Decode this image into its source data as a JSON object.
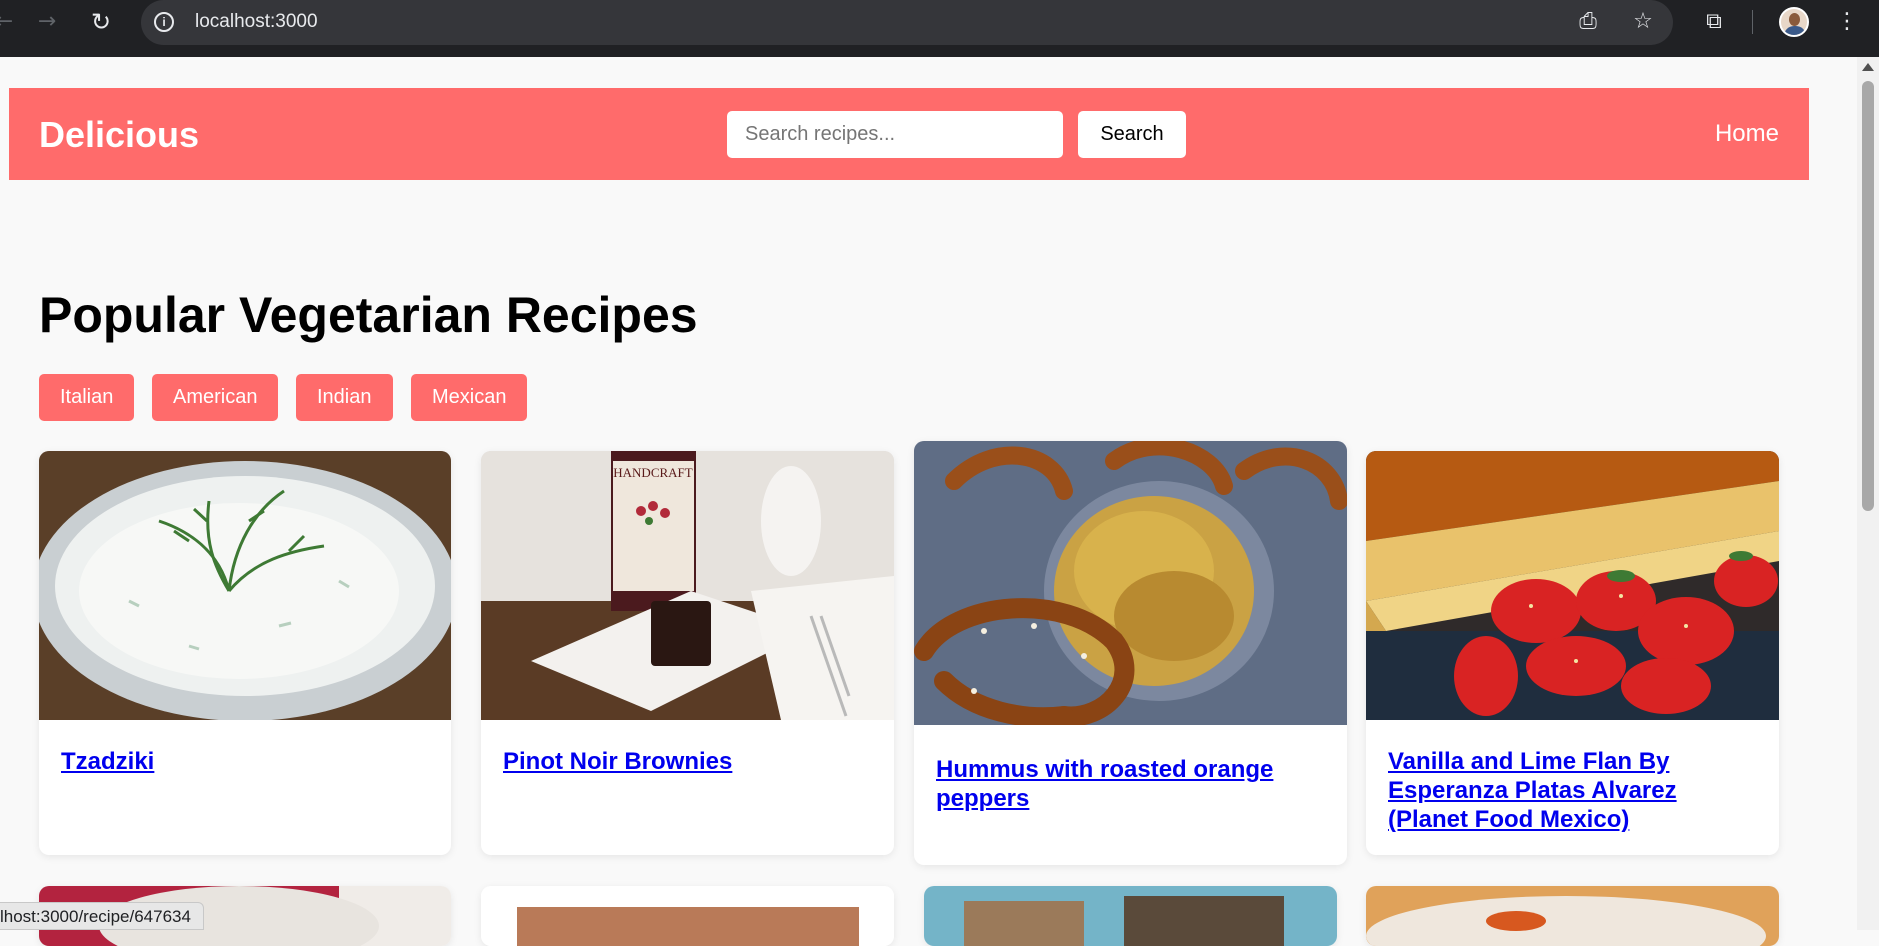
{
  "browser": {
    "url": "localhost:3000",
    "status_url": "lhost:3000/recipe/647634"
  },
  "header": {
    "brand": "Delicious",
    "search_placeholder": "Search recipes...",
    "search_button": "Search",
    "home_link": "Home",
    "accent_color": "#ff6b6b"
  },
  "main": {
    "title": "Popular Vegetarian Recipes",
    "cuisines": [
      "Italian",
      "American",
      "Indian",
      "Mexican"
    ],
    "recipes": [
      {
        "title": "Tzadziki",
        "image": "bowl of tzatziki with dill"
      },
      {
        "title": "Pinot Noir Brownies",
        "image": "brownie on plate with wine bottle"
      },
      {
        "title": "Hummus with roasted orange peppers",
        "image": "orange hummus with pretzels"
      },
      {
        "title": "Vanilla and Lime Flan By Esperanza Platas Alvarez (Planet Food Mexico)",
        "image": "flan slice with strawberries"
      }
    ]
  }
}
